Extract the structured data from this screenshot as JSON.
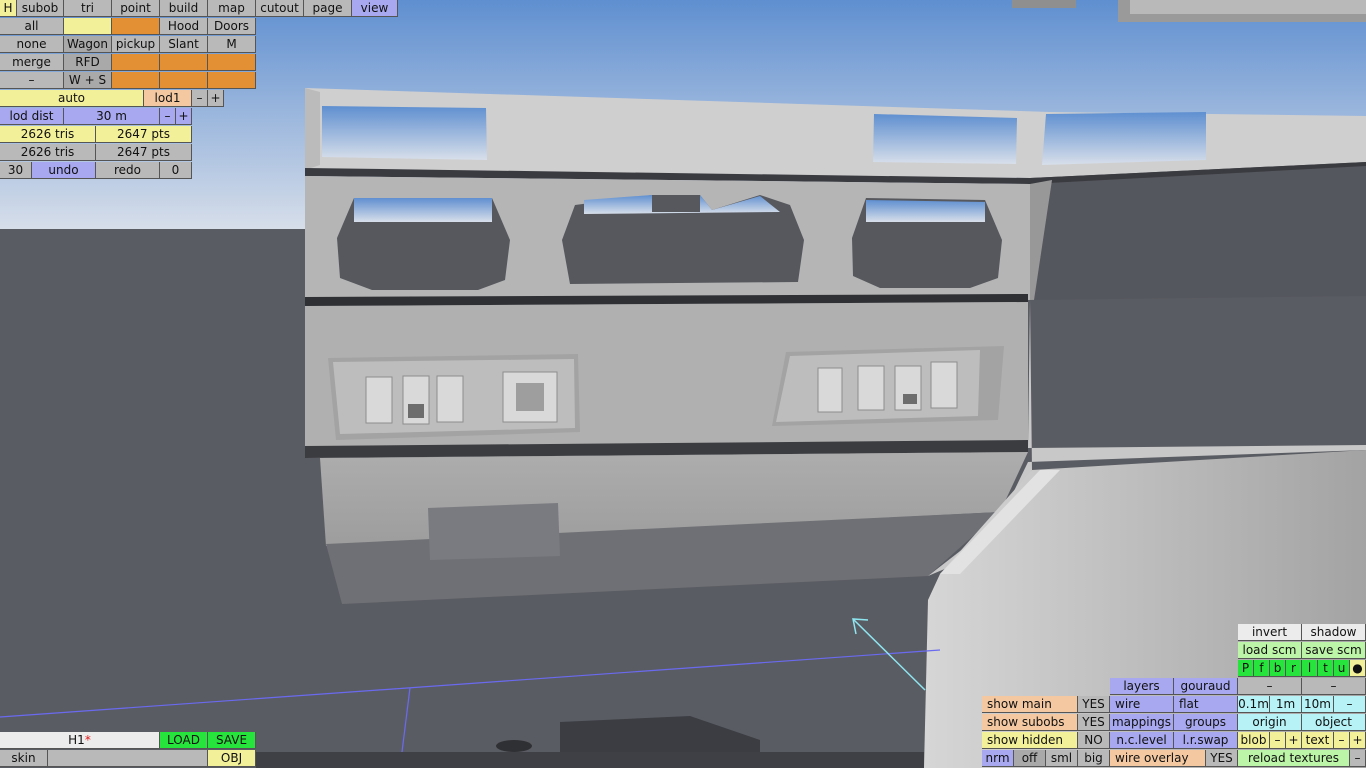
{
  "toolbar_top": {
    "h": "H",
    "tabs": [
      "subob",
      "tri",
      "point",
      "build",
      "map",
      "cutout",
      "page",
      "view"
    ],
    "active_tab": "view"
  },
  "select_panel": {
    "row1": [
      "all",
      "",
      "",
      "Hood",
      "Doors"
    ],
    "row2": [
      "none",
      "Wagon",
      "pickup",
      "Slant",
      "M"
    ],
    "row3": [
      "merge",
      "RFD",
      "",
      "",
      ""
    ],
    "row4": [
      "–",
      "W + S",
      "",
      "",
      ""
    ]
  },
  "lod": {
    "mode": "auto",
    "level": "lod1",
    "minus": "–",
    "plus": "+",
    "dist_label": "lod dist",
    "dist_value": "30 m"
  },
  "stats": {
    "tris1": "2626 tris",
    "pts1": "2647 pts",
    "tris2": "2626 tris",
    "pts2": "2647 pts"
  },
  "undo": {
    "count": "30",
    "undo": "undo",
    "redo": "redo",
    "redo_count": "0"
  },
  "file_panel": {
    "name": "H1",
    "modified_mark": "*",
    "load": "LOAD",
    "save": "SAVE",
    "skin": "skin",
    "skin_value": "",
    "obj": "OBJ"
  },
  "view_options": {
    "show_main": "show main",
    "show_main_val": "YES",
    "show_subobs": "show subobs",
    "show_subobs_val": "YES",
    "show_hidden": "show hidden",
    "show_hidden_val": "NO",
    "size_opts": [
      "nrm",
      "off",
      "sml",
      "big"
    ],
    "layers": "layers",
    "gouraud": "gouraud",
    "wire": "wire",
    "flat": "flat",
    "mappings": "mappings",
    "groups": "groups",
    "nclevel": "n.c.level",
    "lrswap": "l.r.swap",
    "wire_overlay": "wire overlay",
    "wire_overlay_val": "YES"
  },
  "right_panel": {
    "invert": "invert",
    "shadow": "shadow",
    "load_scm": "load scm",
    "save_scm": "save scm",
    "view_keys": [
      "P",
      "f",
      "b",
      "r",
      "l",
      "t",
      "u",
      "●"
    ],
    "dash1": "–",
    "dash2": "–",
    "grid": [
      "0.1m",
      "1m",
      "10m",
      "–"
    ],
    "origin": "origin",
    "object": "object",
    "blob": "blob",
    "text": "text",
    "minus": "–",
    "plus": "+",
    "reload": "reload textures",
    "reload_minus": "–"
  },
  "colors": {
    "sky_top": "#5f8fd0",
    "sky_bottom": "#d8dfea",
    "floor": "#5a5c63",
    "active_tab": "#a8a8f0",
    "green": "#27e43c",
    "orange": "#e38f34",
    "yellow": "#f3f09a"
  }
}
